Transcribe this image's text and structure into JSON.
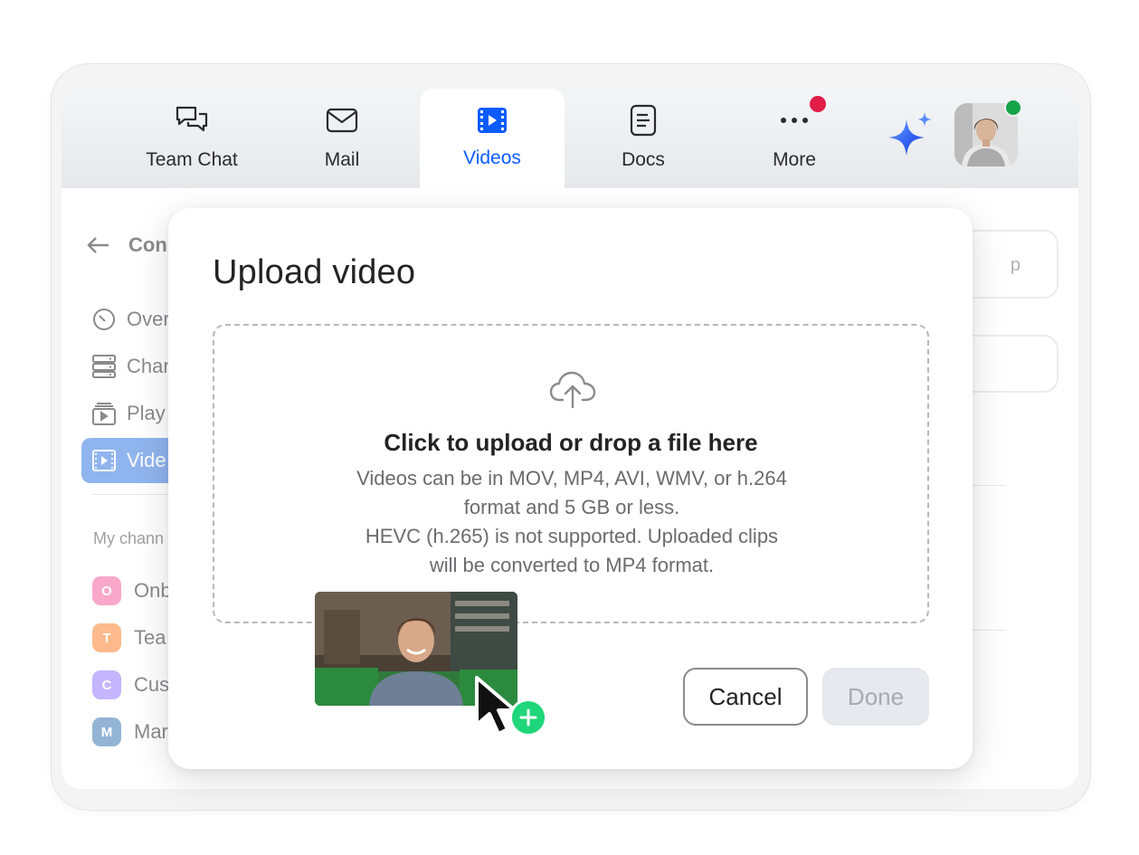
{
  "nav": {
    "tabs": [
      {
        "label": "Team Chat",
        "icon": "chat-bubbles-icon"
      },
      {
        "label": "Mail",
        "icon": "envelope-icon"
      },
      {
        "label": "Videos",
        "icon": "film-icon",
        "active": true
      },
      {
        "label": "Docs",
        "icon": "document-icon"
      },
      {
        "label": "More",
        "icon": "more-dots-icon",
        "notification": true
      }
    ],
    "assistant_icon": "ai-sparkle-icon",
    "avatar_status": "online"
  },
  "sidebar": {
    "back_label": "Con",
    "items": [
      {
        "label": "Over",
        "icon": "gauge-icon"
      },
      {
        "label": "Chan",
        "icon": "server-list-icon"
      },
      {
        "label": "Play",
        "icon": "playlist-icon"
      },
      {
        "label": "Vide",
        "icon": "film-icon",
        "active": true
      }
    ],
    "section_label": "My chann",
    "channels": [
      {
        "initial": "O",
        "label": "Onb",
        "color": "#f9a8c9"
      },
      {
        "initial": "T",
        "label": "Tea",
        "color": "#fdba8c"
      },
      {
        "initial": "C",
        "label": "Cus",
        "color": "#c4b5fd"
      },
      {
        "initial": "M",
        "label": "Mar",
        "color": "#93b4d4"
      }
    ]
  },
  "background_field": {
    "partial_text": "p"
  },
  "modal": {
    "title": "Upload video",
    "dropzone": {
      "icon": "cloud-upload-icon",
      "title": "Click to upload or drop a file here",
      "line1": "Videos can be in MOV, MP4, AVI, WMV, or h.264",
      "line2": "format and 5 GB or less.",
      "line3": "HEVC (h.265) is not supported. Uploaded clips",
      "line4": "will be converted to MP4 format."
    },
    "cancel_label": "Cancel",
    "done_label": "Done"
  },
  "colors": {
    "accent": "#0b5cff",
    "notification": "#e11d48",
    "online": "#16a34a",
    "add": "#1fd67a"
  }
}
